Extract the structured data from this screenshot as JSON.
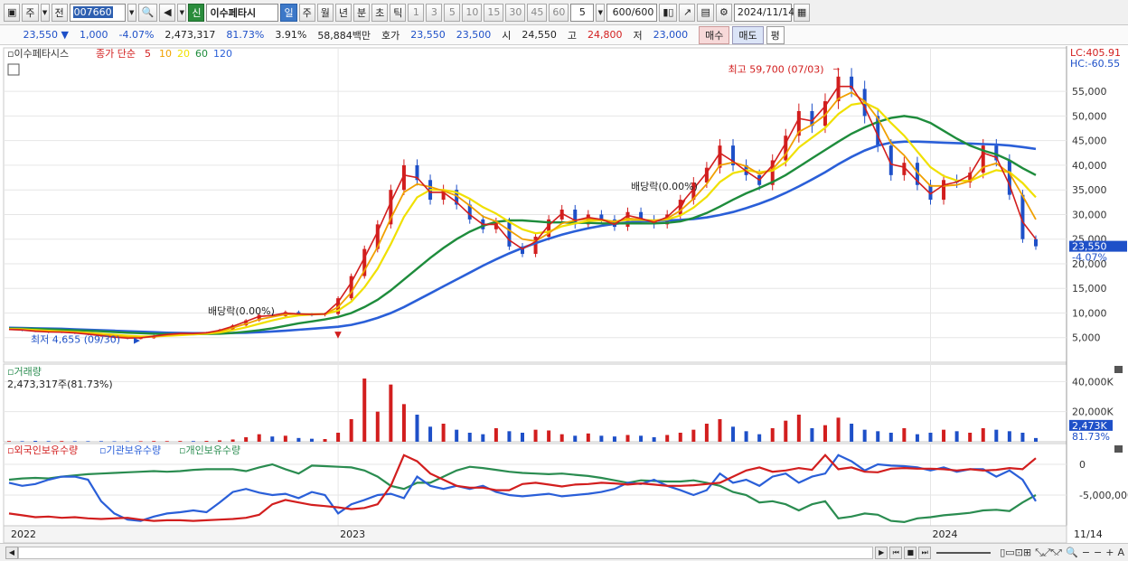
{
  "toolbar": {
    "market": "주",
    "prev_label": "전",
    "code": "007660",
    "name": "이수페타시",
    "period_tabs": [
      "일",
      "주",
      "월",
      "년",
      "분",
      "초",
      "틱"
    ],
    "active_tab": "일",
    "intervals": [
      "1",
      "3",
      "5",
      "10",
      "15",
      "30",
      "45",
      "60"
    ],
    "interval_value": "5",
    "count": "600",
    "count_total": "/600",
    "date": "2024/11/14",
    "new_badge": "신"
  },
  "quote": {
    "price": "23,550",
    "change": "1,000",
    "change_pct": "-4.07%",
    "volume": "2,473,317",
    "vol_ratio": "81.73%",
    "turnover_pct": "3.91%",
    "amount": "58,884백만",
    "bid_label": "호가",
    "ask": "23,550",
    "bid": "23,500",
    "open_label": "시",
    "open": "24,550",
    "high_label": "고",
    "high": "24,800",
    "low_label": "저",
    "low": "23,000",
    "buy_label": "매수",
    "sell_label": "매도",
    "p_label": "평"
  },
  "chart_data": [
    {
      "type": "line",
      "panel": "price",
      "title": "",
      "legend_label": "이수페타시스",
      "ma_label": "종가 단순",
      "ma_periods": [
        "5",
        "10",
        "20",
        "60",
        "120"
      ],
      "ma_colors": [
        "#d21e1e",
        "#f0a000",
        "#f0e000",
        "#1e8c3c",
        "#2a5fd8"
      ],
      "yticks": [
        5000,
        10000,
        15000,
        20000,
        25000,
        30000,
        35000,
        40000,
        45000,
        50000,
        55000
      ],
      "ytick_labels": [
        "5,000",
        "10,000",
        "15,000",
        "20,000",
        "25,000",
        "30,000",
        "35,000",
        "40,000",
        "45,000",
        "50,000",
        "55,000"
      ],
      "ylim": [
        0,
        62000
      ],
      "lc_label": "LC:405.91",
      "hc_label": "HC:-60.55",
      "current_label": "23,550",
      "current_pct": "-4.07%",
      "x_labels": [
        "2022",
        "2023",
        "2024"
      ],
      "last_date_label": "11/14",
      "annotations": {
        "high": "최고 59,700 (07/03)",
        "low": "최저 4,655 (09/30)",
        "dividend": "배당락(0.00%)"
      },
      "close": [
        6600,
        6500,
        6300,
        6100,
        6200,
        5900,
        5600,
        5300,
        5000,
        4800,
        4900,
        5400,
        5700,
        5900,
        5800,
        6000,
        6600,
        7500,
        8500,
        9600,
        9400,
        10200,
        9700,
        9600,
        9800,
        13000,
        17500,
        23000,
        28000,
        35000,
        40000,
        37000,
        33000,
        35000,
        32000,
        29000,
        27000,
        28500,
        23500,
        22000,
        25500,
        29000,
        31000,
        28000,
        30000,
        29000,
        27500,
        30500,
        29000,
        28000,
        30000,
        33000,
        36500,
        39500,
        44000,
        40000,
        38000,
        36000,
        41000,
        46000,
        51000,
        48000,
        53000,
        58000,
        55500,
        50000,
        44000,
        38000,
        40500,
        36000,
        33000,
        37000,
        36500,
        38500,
        44000,
        41000,
        34000,
        25000,
        23550
      ],
      "ma5": [
        6650,
        6550,
        6300,
        6150,
        6100,
        5950,
        5700,
        5400,
        5100,
        4900,
        4950,
        5300,
        5650,
        5850,
        5850,
        6000,
        6500,
        7300,
        8300,
        9300,
        9500,
        10000,
        9800,
        9700,
        9800,
        12200,
        16200,
        21200,
        26500,
        32500,
        38000,
        37500,
        34500,
        34500,
        32500,
        30000,
        28000,
        28000,
        24800,
        23000,
        24500,
        27800,
        30200,
        28800,
        29400,
        29000,
        28000,
        29800,
        29200,
        28400,
        29500,
        32000,
        35200,
        38500,
        42500,
        40800,
        38800,
        37000,
        40000,
        44500,
        49500,
        49000,
        52000,
        56000,
        56000,
        51800,
        46000,
        40200,
        39600,
        36800,
        34200,
        36000,
        36600,
        38000,
        42500,
        41600,
        36000,
        28500,
        25000
      ],
      "ma10": [
        6700,
        6600,
        6400,
        6250,
        6150,
        6050,
        5850,
        5600,
        5350,
        5100,
        5000,
        5200,
        5500,
        5700,
        5800,
        5950,
        6300,
        7000,
        7800,
        8700,
        9200,
        9700,
        9800,
        9800,
        9800,
        11200,
        14200,
        18600,
        23400,
        29200,
        34500,
        36200,
        35600,
        34800,
        33800,
        31800,
        29600,
        28600,
        26800,
        25000,
        24600,
        26200,
        28200,
        28800,
        29100,
        29000,
        28500,
        29200,
        29000,
        28700,
        29200,
        30800,
        33200,
        36200,
        40000,
        40600,
        39800,
        38200,
        39200,
        42200,
        46800,
        48200,
        50200,
        53500,
        54800,
        53000,
        49500,
        44500,
        42000,
        38600,
        35800,
        35800,
        36000,
        36800,
        39600,
        40400,
        38400,
        33800,
        29000
      ],
      "ma20": [
        6750,
        6700,
        6550,
        6400,
        6250,
        6150,
        6000,
        5800,
        5600,
        5400,
        5250,
        5250,
        5350,
        5500,
        5650,
        5800,
        6050,
        6500,
        7100,
        7800,
        8500,
        9100,
        9500,
        9700,
        9800,
        10500,
        12300,
        15200,
        19000,
        24000,
        29500,
        33500,
        35000,
        35000,
        34500,
        33200,
        31500,
        30200,
        28500,
        27000,
        26200,
        26500,
        27600,
        28200,
        28700,
        28800,
        28600,
        28900,
        28900,
        28800,
        29000,
        29800,
        31400,
        33600,
        36600,
        38400,
        39000,
        38600,
        38900,
        40600,
        43600,
        45600,
        47600,
        50400,
        52300,
        52700,
        51400,
        48600,
        46000,
        42800,
        39600,
        37800,
        36900,
        36800,
        38000,
        39000,
        38600,
        36400,
        33500
      ],
      "ma60": [
        6900,
        6850,
        6800,
        6700,
        6600,
        6500,
        6400,
        6300,
        6150,
        6000,
        5900,
        5800,
        5750,
        5700,
        5700,
        5750,
        5800,
        5950,
        6200,
        6500,
        6900,
        7400,
        7900,
        8300,
        8700,
        9200,
        10000,
        11200,
        12700,
        14600,
        16800,
        19000,
        21200,
        23200,
        25000,
        26500,
        27700,
        28500,
        28800,
        28800,
        28600,
        28400,
        28400,
        28300,
        28300,
        28200,
        28200,
        28200,
        28200,
        28200,
        28300,
        28600,
        29300,
        30300,
        31600,
        33000,
        34300,
        35400,
        36600,
        38000,
        39700,
        41400,
        43100,
        44800,
        46400,
        47700,
        48800,
        49600,
        50000,
        49600,
        48600,
        47000,
        45400,
        44000,
        43000,
        42200,
        41000,
        39400,
        38000
      ],
      "ma120": [
        7000,
        6950,
        6900,
        6850,
        6800,
        6700,
        6600,
        6500,
        6400,
        6300,
        6200,
        6100,
        6000,
        5950,
        5900,
        5900,
        5900,
        5950,
        6000,
        6100,
        6250,
        6400,
        6600,
        6800,
        7000,
        7200,
        7600,
        8200,
        9000,
        10000,
        11200,
        12600,
        14000,
        15400,
        16800,
        18200,
        19600,
        20900,
        22100,
        23200,
        24200,
        25100,
        25900,
        26600,
        27200,
        27700,
        28100,
        28400,
        28600,
        28700,
        28800,
        28900,
        29100,
        29400,
        29900,
        30500,
        31300,
        32200,
        33200,
        34400,
        35700,
        37100,
        38600,
        40200,
        41700,
        43000,
        44000,
        44600,
        44800,
        44800,
        44700,
        44600,
        44500,
        44400,
        44300,
        44200,
        44000,
        43700,
        43300
      ]
    },
    {
      "type": "bar",
      "panel": "volume",
      "title": "거래량",
      "value_label": "2,473,317주(81.73%)",
      "yticks": [
        20000,
        40000
      ],
      "ytick_labels": [
        "20,000K",
        "40,000K"
      ],
      "current_label": "2,473K",
      "current_pct": "81.73%",
      "ylim": [
        0,
        48000
      ],
      "values": [
        500,
        400,
        600,
        450,
        500,
        400,
        380,
        420,
        350,
        300,
        400,
        500,
        450,
        520,
        480,
        600,
        900,
        1500,
        3000,
        5000,
        3500,
        4000,
        2500,
        2000,
        1800,
        6000,
        15000,
        42000,
        20000,
        38000,
        25000,
        18000,
        10000,
        12000,
        8000,
        6000,
        5000,
        9000,
        7000,
        6000,
        8000,
        7500,
        5000,
        4000,
        5500,
        4000,
        3500,
        4500,
        4000,
        3000,
        4500,
        6000,
        8000,
        12000,
        15000,
        10000,
        7000,
        5000,
        9000,
        14000,
        18000,
        9000,
        11000,
        16000,
        12000,
        8000,
        7000,
        6000,
        9000,
        5000,
        6000,
        8000,
        7000,
        6000,
        9000,
        8000,
        7000,
        6000,
        2473
      ]
    },
    {
      "type": "line",
      "panel": "holdings",
      "series_names": [
        "외국인보유수량",
        "기관보유수량",
        "개인보유수량"
      ],
      "series_colors": [
        "#d21e1e",
        "#2a5fd8",
        "#2a8c50"
      ],
      "yticks": [
        0,
        -5000000
      ],
      "ytick_labels": [
        "0",
        "-5,000,000"
      ],
      "ylim": [
        -10000000,
        2500000
      ],
      "foreign": [
        -8000,
        -8300,
        -8600,
        -8500,
        -8700,
        -8600,
        -8800,
        -8900,
        -8800,
        -8700,
        -9000,
        -9200,
        -9100,
        -9100,
        -9200,
        -9100,
        -9000,
        -8900,
        -8700,
        -8200,
        -6500,
        -5800,
        -6200,
        -6600,
        -6800,
        -7000,
        -7300,
        -7100,
        -6500,
        -3500,
        1500,
        500,
        -1500,
        -2500,
        -3500,
        -3800,
        -3800,
        -4200,
        -4200,
        -3200,
        -3000,
        -3300,
        -3600,
        -3300,
        -3200,
        -3000,
        -3100,
        -3300,
        -3100,
        -3300,
        -3500,
        -3500,
        -3400,
        -3200,
        -3000,
        -2000,
        -1000,
        -500,
        -1200,
        -1000,
        -600,
        -900,
        1500,
        -800,
        -500,
        -1200,
        -1300,
        -700,
        -600,
        -700,
        -700,
        -800,
        -1000,
        -800,
        -1000,
        -900,
        -600,
        -800,
        1000
      ],
      "institution": [
        -3000,
        -3500,
        -3200,
        -2500,
        -2000,
        -2000,
        -2500,
        -6000,
        -8000,
        -9000,
        -9200,
        -8500,
        -8000,
        -7800,
        -7500,
        -7800,
        -6200,
        -4500,
        -4000,
        -4600,
        -5000,
        -4800,
        -5500,
        -4500,
        -5000,
        -8000,
        -6500,
        -5800,
        -5000,
        -4800,
        -5500,
        -2000,
        -3500,
        -4000,
        -3500,
        -4000,
        -3500,
        -4500,
        -5000,
        -5200,
        -5000,
        -4800,
        -5200,
        -5000,
        -4800,
        -4500,
        -4000,
        -3000,
        -3200,
        -2500,
        -3500,
        -4200,
        -5000,
        -4200,
        -1500,
        -3000,
        -2500,
        -3500,
        -2000,
        -1500,
        -3000,
        -2000,
        -1500,
        1500,
        500,
        -1000,
        0,
        -200,
        -300,
        -500,
        -1000,
        -500,
        -1200,
        -800,
        -800,
        -2000,
        -1000,
        -2500,
        -6000
      ],
      "individual": [
        -2500,
        -2300,
        -2200,
        -2300,
        -2000,
        -1800,
        -1600,
        -1500,
        -1400,
        -1300,
        -1200,
        -1100,
        -1200,
        -1100,
        -900,
        -800,
        -800,
        -800,
        -1100,
        -500,
        0,
        -800,
        -1500,
        -200,
        -300,
        -400,
        -500,
        -1000,
        -2000,
        -3500,
        -4000,
        -3000,
        -3000,
        -2000,
        -1000,
        -400,
        -600,
        -900,
        -1200,
        -1400,
        -1500,
        -1600,
        -1500,
        -1700,
        -1900,
        -2200,
        -2600,
        -3000,
        -2600,
        -2700,
        -2800,
        -2800,
        -2600,
        -3000,
        -3500,
        -4500,
        -5000,
        -6200,
        -6000,
        -6500,
        -7500,
        -6500,
        -6000,
        -8800,
        -8500,
        -8000,
        -8200,
        -9200,
        -9400,
        -8800,
        -8600,
        -8300,
        -8100,
        -7900,
        -7500,
        -7400,
        -7600,
        -6200,
        -5000
      ]
    }
  ],
  "bottom": {
    "controls": [
      "▶",
      "⏮",
      "■",
      "⏭"
    ]
  }
}
